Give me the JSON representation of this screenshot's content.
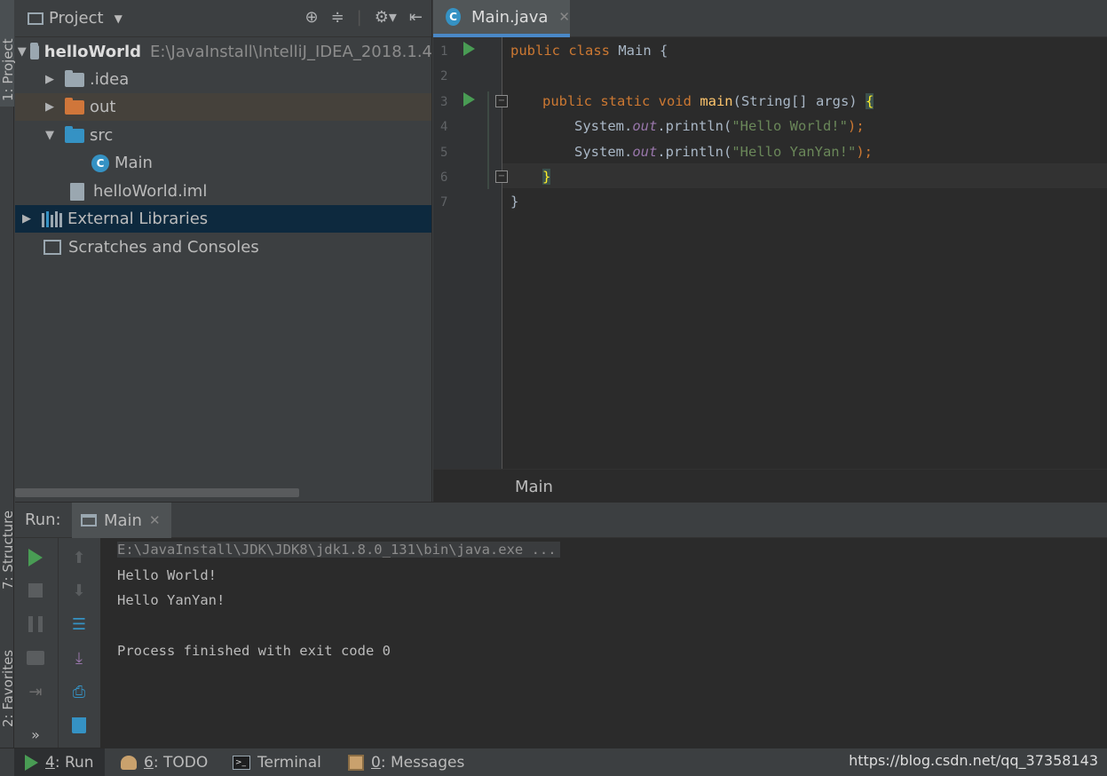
{
  "side_tabs": {
    "project": "1: Project",
    "structure": "7: Structure",
    "favorites": "2: Favorites"
  },
  "project_panel": {
    "title": "Project",
    "tree": [
      {
        "label": "helloWorld",
        "path": "E:\\JavaInstall\\IntelliJ_IDEA_2018.1.4",
        "icon": "module-folder-icon",
        "expanded": true
      },
      {
        "label": ".idea",
        "icon": "folder-icon",
        "expanded": false
      },
      {
        "label": "out",
        "icon": "excluded-folder-icon",
        "expanded": false
      },
      {
        "label": "src",
        "icon": "source-folder-icon",
        "expanded": true
      },
      {
        "label": "Main",
        "icon": "java-class-icon"
      },
      {
        "label": "helloWorld.iml",
        "icon": "iml-file-icon"
      },
      {
        "label": "External Libraries",
        "icon": "libraries-icon",
        "expanded": false,
        "selected": true
      },
      {
        "label": "Scratches and Consoles",
        "icon": "scratches-icon"
      }
    ]
  },
  "editor": {
    "tab_label": "Main.java",
    "line_numbers": [
      "1",
      "2",
      "3",
      "4",
      "5",
      "6",
      "7"
    ],
    "code": {
      "l1_kw": "public class ",
      "l1_rest": "Main {",
      "l3_kw": "public static void ",
      "l3_fn": "main",
      "l3_rest": "(String[] args) ",
      "l3_brace": "{",
      "l4_pre": "System.",
      "l4_fld": "out",
      "l4_mid": ".println(",
      "l4_str": "\"Hello World!\"",
      "l4_end": ");",
      "l5_pre": "System.",
      "l5_fld": "out",
      "l5_mid": ".println(",
      "l5_str": "\"Hello YanYan!\"",
      "l5_end": ");",
      "l6": "}",
      "l7": "}"
    },
    "breadcrumb": "Main"
  },
  "run_panel": {
    "label": "Run:",
    "tab_label": "Main",
    "console": [
      "E:\\JavaInstall\\JDK\\JDK8\\jdk1.8.0_131\\bin\\java.exe ...",
      "Hello World!",
      "Hello YanYan!",
      "",
      "Process finished with exit code 0"
    ]
  },
  "status_bar": {
    "run_num": "4",
    "run_label": ": Run",
    "todo_num": "6",
    "todo_label": ": TODO",
    "terminal_label": "Terminal",
    "messages_num": "0",
    "messages_label": ": Messages",
    "url": "https://blog.csdn.net/qq_37358143"
  },
  "colors": {
    "background": "#3c3f41",
    "editor_bg": "#2b2b2b",
    "keyword": "#cc7832",
    "string": "#6a8759",
    "method": "#ffc66d",
    "field": "#9876aa",
    "selection": "#0d293e",
    "run_green": "#499c54"
  }
}
